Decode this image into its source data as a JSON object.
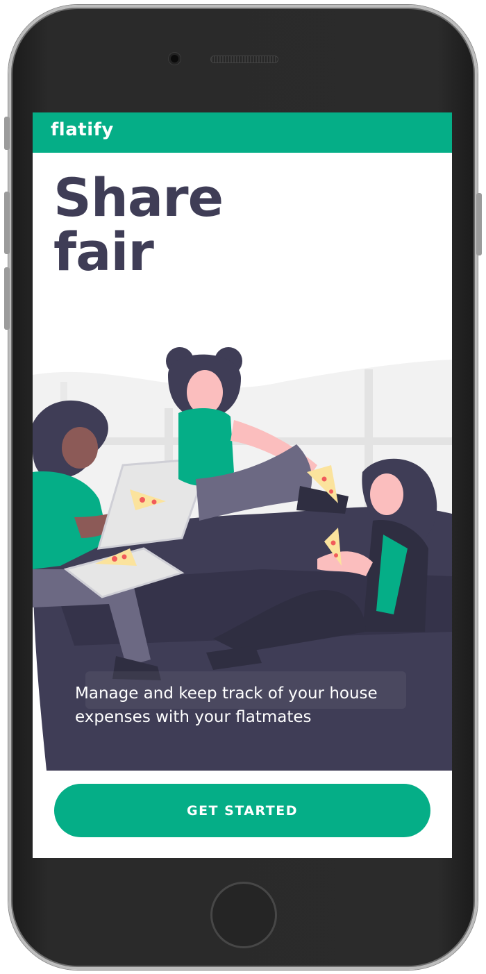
{
  "app": {
    "brand": "flatify"
  },
  "hero": {
    "headline_line1": "Share",
    "headline_line2": "fair",
    "subtitle_line1": "Manage and keep track of your house",
    "subtitle_line2": "expenses with your flatmates"
  },
  "actions": {
    "get_started_label": "GET STARTED"
  },
  "colors": {
    "brand_green": "#05ae87",
    "headline": "#3f3d56",
    "sofa": "#3f3d56",
    "shirt_green": "#05ae87"
  },
  "icons": [
    "camera-icon",
    "speaker-grille",
    "home-button-icon",
    "pizza-slice-icon"
  ]
}
